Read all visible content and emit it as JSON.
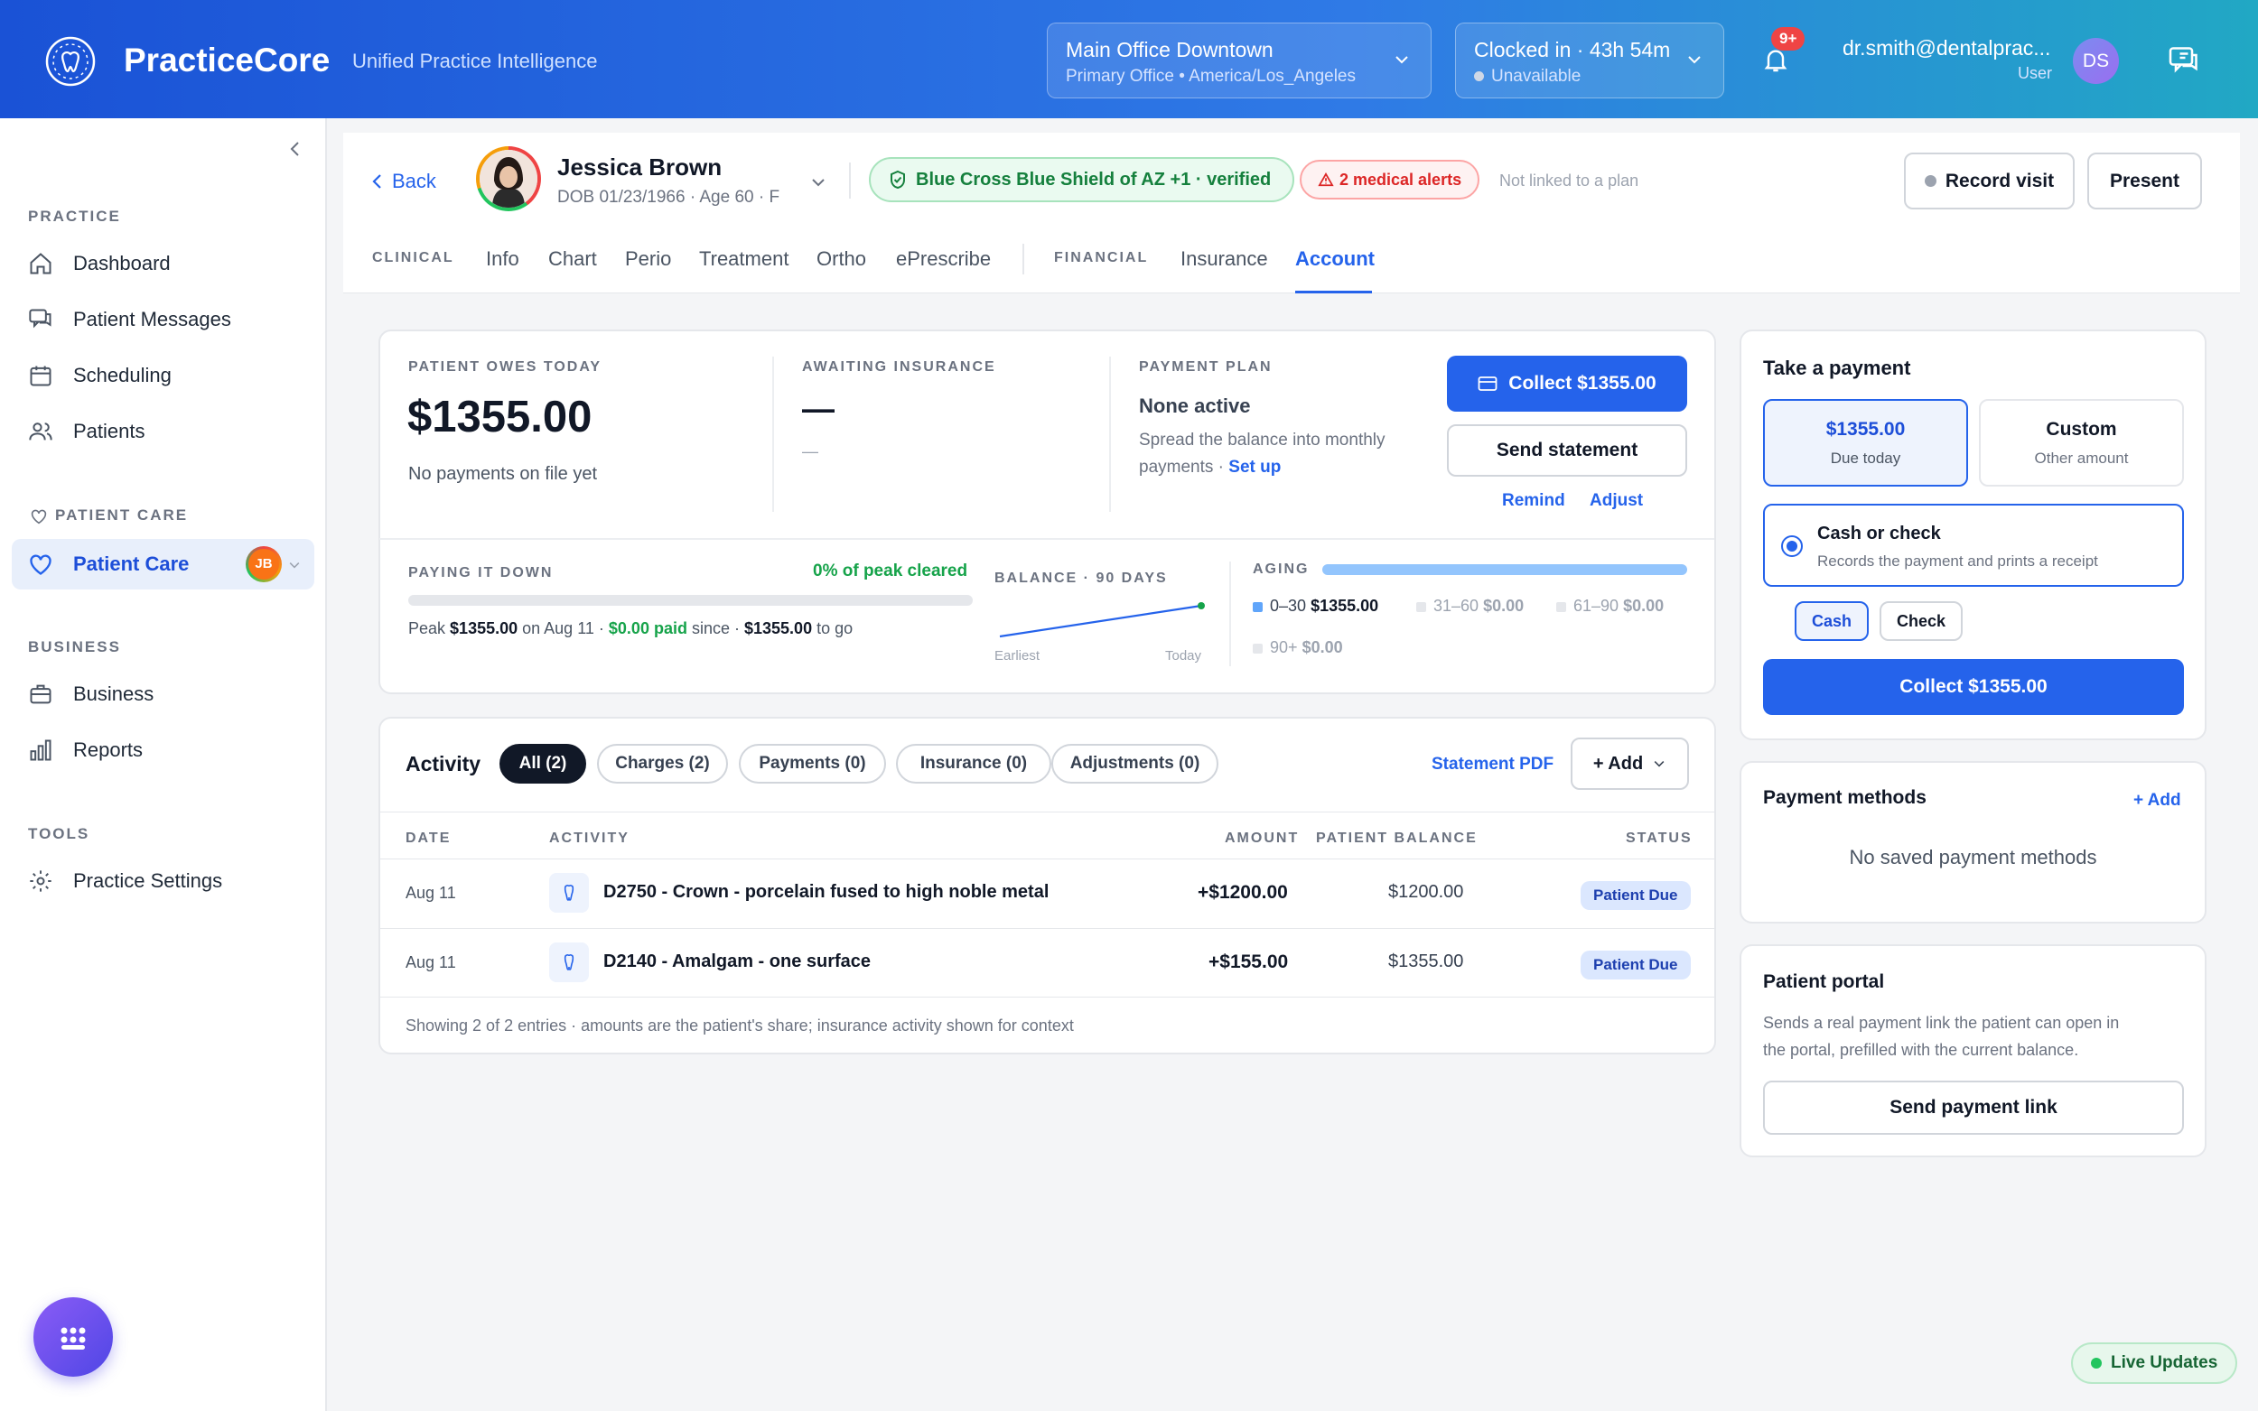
{
  "app": {
    "name": "PracticeCore",
    "tagline": "Unified Practice Intelligence"
  },
  "topbar": {
    "location": {
      "name": "Main Office Downtown",
      "detail": "Primary Office • America/Los_Angeles"
    },
    "clock": {
      "status": "Clocked in · 43h 54m",
      "availability": "Unavailable"
    },
    "notifications_badge": "9+",
    "user": {
      "email": "dr.smith@dentalprac...",
      "role": "User",
      "initials": "DS"
    }
  },
  "sidebar": {
    "sections": {
      "practice": "PRACTICE",
      "patient_care": "PATIENT CARE",
      "business": "BUSINESS",
      "tools": "TOOLS"
    },
    "items": {
      "dashboard": "Dashboard",
      "messages": "Patient Messages",
      "scheduling": "Scheduling",
      "patients": "Patients",
      "patient_care": "Patient Care",
      "business": "Business",
      "reports": "Reports",
      "settings": "Practice Settings"
    },
    "patient_care_avatar": "JB"
  },
  "patient": {
    "name": "Jessica Brown",
    "meta": "DOB 01/23/1966 · Age 60 · F",
    "insurance": "Blue Cross Blue Shield of AZ +1 · verified",
    "alerts": "2 medical alerts",
    "plan_status": "Not linked to a plan",
    "back_label": "Back"
  },
  "actions": {
    "record_visit": "Record visit",
    "present": "Present"
  },
  "tabs": {
    "clinical_label": "CLINICAL",
    "clinical": [
      "Info",
      "Chart",
      "Perio",
      "Treatment",
      "Ortho",
      "ePrescribe"
    ],
    "financial_label": "FINANCIAL",
    "insurance": "Insurance",
    "account": "Account"
  },
  "summary": {
    "owes_label": "PATIENT OWES TODAY",
    "owes_amount": "$1355.00",
    "owes_note": "No payments on file yet",
    "awaiting_label": "AWAITING INSURANCE",
    "awaiting_value": "—",
    "awaiting_sub": "—",
    "plan_label": "PAYMENT PLAN",
    "plan_value": "None active",
    "plan_desc1": "Spread the balance into monthly",
    "plan_desc2": "payments ·",
    "plan_setup": "Set up",
    "collect_label": "Collect $1355.00",
    "send_statement": "Send statement",
    "remind": "Remind",
    "adjust": "Adjust",
    "paying_label": "PAYING IT DOWN",
    "peak_cleared": "0% of peak cleared",
    "progress_fraction": 0,
    "peak_prefix": "Peak",
    "peak_amount": "$1355.00",
    "peak_date": "on Aug 11 ·",
    "paid_amount": "$0.00 paid",
    "paid_since": "since ·",
    "to_go_amount": "$1355.00",
    "to_go": "to go",
    "balance_label": "BALANCE · 90 DAYS",
    "balance_start": "Earliest",
    "balance_end": "Today",
    "aging_label": "AGING",
    "aging": [
      {
        "bucket": "0–30",
        "amount": "$1355.00",
        "color": "#60a5fa"
      },
      {
        "bucket": "31–60",
        "amount": "$0.00",
        "color": "#e5e7eb"
      },
      {
        "bucket": "61–90",
        "amount": "$0.00",
        "color": "#e5e7eb"
      },
      {
        "bucket": "90+",
        "amount": "$0.00",
        "color": "#e5e7eb"
      }
    ]
  },
  "activity": {
    "title": "Activity",
    "filters": [
      "All (2)",
      "Charges (2)",
      "Payments (0)",
      "Insurance (0)",
      "Adjustments (0)"
    ],
    "statement_pdf": "Statement PDF",
    "add": "+ Add",
    "headers": {
      "date": "DATE",
      "activity": "ACTIVITY",
      "amount": "AMOUNT",
      "balance": "PATIENT BALANCE",
      "status": "STATUS"
    },
    "rows": [
      {
        "date": "Aug 11",
        "activity": "D2750 - Crown - porcelain fused to high noble metal",
        "amount": "+$1200.00",
        "balance": "$1200.00",
        "status": "Patient Due"
      },
      {
        "date": "Aug 11",
        "activity": "D2140 - Amalgam - one surface",
        "amount": "+$155.00",
        "balance": "$1355.00",
        "status": "Patient Due"
      }
    ],
    "footer": "Showing 2 of 2 entries · amounts are the patient's share; insurance activity shown for context"
  },
  "take_payment": {
    "title": "Take a payment",
    "due_amount": "$1355.00",
    "due_label": "Due today",
    "custom": "Custom",
    "custom_sub": "Other amount",
    "method_title": "Cash or check",
    "method_desc": "Records the payment and prints a receipt",
    "cash": "Cash",
    "check": "Check",
    "collect": "Collect $1355.00"
  },
  "payment_methods": {
    "title": "Payment methods",
    "add": "+ Add",
    "empty": "No saved payment methods"
  },
  "portal": {
    "title": "Patient portal",
    "desc1": "Sends a real payment link the patient can open in",
    "desc2": "the portal, prefilled with the current balance.",
    "send": "Send payment link"
  },
  "live_updates": "Live Updates",
  "colors": {
    "primary": "#2563eb",
    "success": "#16a34a",
    "danger": "#dc2626"
  }
}
